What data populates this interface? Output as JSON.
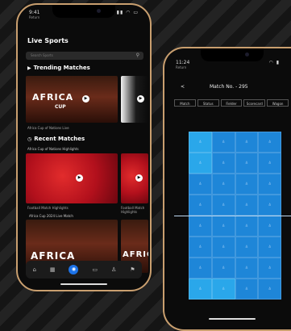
{
  "left_phone": {
    "status": {
      "time": "9:41",
      "sub": "Return",
      "icons": "▮▮ ◠ ▭"
    },
    "title": "Live Sports",
    "search_placeholder": "Search Sports",
    "trending": {
      "title": "Trending Matches",
      "cards": [
        {
          "caption": "Africa Cup of Nations Live",
          "big": "AFRICA",
          "small": "CUP"
        },
        {
          "caption": "",
          "big": "",
          "small": ""
        }
      ]
    },
    "recent": {
      "title": "Recent Matches",
      "header": "Africa Cup of Nations Highlights",
      "cards": [
        {
          "caption": "Football Match Highlights"
        },
        {
          "caption": "Football Match Highlights"
        }
      ]
    },
    "third": {
      "header": "Africa Cup 2024 Live Match",
      "cards": [
        {
          "big": "AFRICA"
        },
        {
          "big": "AFRICA"
        }
      ]
    },
    "nav": [
      "⌂",
      "▦",
      "◉",
      "▭",
      "♙",
      "⚑"
    ]
  },
  "right_phone": {
    "status": {
      "time": "11:24",
      "sub": "Return",
      "icons": "◠ ▮"
    },
    "header": {
      "back": "<",
      "title": "Match No. - 295"
    },
    "tabs": [
      "Match",
      "Status",
      "Fielder",
      "Scorecard",
      "Wagon"
    ]
  },
  "colors": {
    "frame": "#c99f6f",
    "pitch": "#1e86d8",
    "accent": "#1d73e8"
  }
}
